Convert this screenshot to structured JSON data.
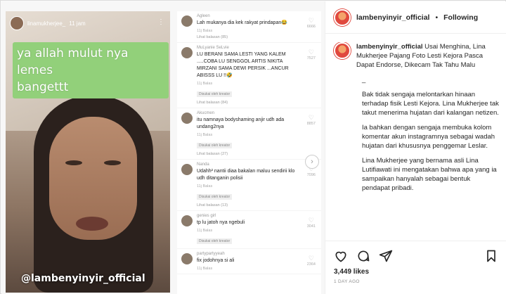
{
  "post": {
    "video_username": "linamukherjee_",
    "video_time": "11 jam",
    "caption_line1": "ya allah mulut nya lemes",
    "caption_line2": "bangettt",
    "watermark": "@lambenyinyir_official"
  },
  "comments": [
    {
      "user": "Agleen",
      "text": "Lah mukanya dia kek rakyat prindapan😂",
      "meta": "11j  Balas",
      "chip": "",
      "more": "Lihat balasan (85)",
      "likes": "6666"
    },
    {
      "user": "MuLyanie SeLvie",
      "text": "LU BERANI SAMA LESTI YANG KALEM .....COBA LU SENGGOL ARTIS NIKITA MIRZANI SAMA DEWI PERSIK ...ANCUR ABISSS LU !!🤣",
      "meta": "11j  Balas",
      "chip": "Disukai oleh kreator",
      "more": "Lihat balasan (84)",
      "likes": "7527"
    },
    {
      "user": "Akucmen",
      "text": "itu namnaya bodyshaming anjir udh ada undang2nya",
      "meta": "11j  Balas",
      "chip": "Disukai oleh kreator",
      "more": "Lihat balasan (27)",
      "likes": "8857"
    },
    {
      "user": "Nanda",
      "text": "Udahh² nantii diaa bakalan maluu sendirii klo udh ditanganin polisii",
      "meta": "11j  Balas",
      "chip": "Disukai oleh kreator",
      "more": "Lihat balasan (13)",
      "likes": "7096"
    },
    {
      "user": "genies girl",
      "text": "tp lu jatoh nya ngebuli",
      "meta": "11j  Balas",
      "chip": "Disukai oleh kreator",
      "more": "",
      "likes": "3041"
    },
    {
      "user": "partypartyyeah",
      "text": "fix jodohnya si ali",
      "meta": "11j  Balas",
      "chip": "",
      "more": "",
      "likes": "2364"
    }
  ],
  "side": {
    "username": "lambenyinyir_official",
    "separator": "•",
    "follow_label": "Following",
    "caption_user": "lambenyinyir_official",
    "caption_headline": "Usai Menghina, Lina Mukherjee Pajang Foto Lesti Kejora Pasca Dapat Endorse, Dikecam Tak Tahu Malu",
    "dash": "_",
    "p1": "Bak tidak sengaja melontarkan hinaan terhadap fisik Lesti Kejora. Lina Mukherjee tak takut menerima hujatan dari kalangan netizen.",
    "p2": "Ia bahkan dengan sengaja membuka kolom komentar akun instagramnya sebagai wadah hujatan dari khususnya penggemar Leslar.",
    "p3": "Lina Mukherjee yang bernama asli Lina Lutifiawati ini mengatakan bahwa apa yang ia sampaikan hanyalah sebagai bentuk pendapat pribadi.",
    "likes": "3,449 likes",
    "posted": "1 DAY AGO"
  },
  "icons": {
    "like": "heart-icon",
    "comment": "comment-icon",
    "share": "share-icon",
    "save": "bookmark-icon",
    "next": "chevron-right-icon",
    "more": "more-dots-icon"
  },
  "colors": {
    "caption_bg": "#92d07a",
    "text": "#262626",
    "muted": "#8e8e8e",
    "avatar_ring": "#e0483e"
  }
}
